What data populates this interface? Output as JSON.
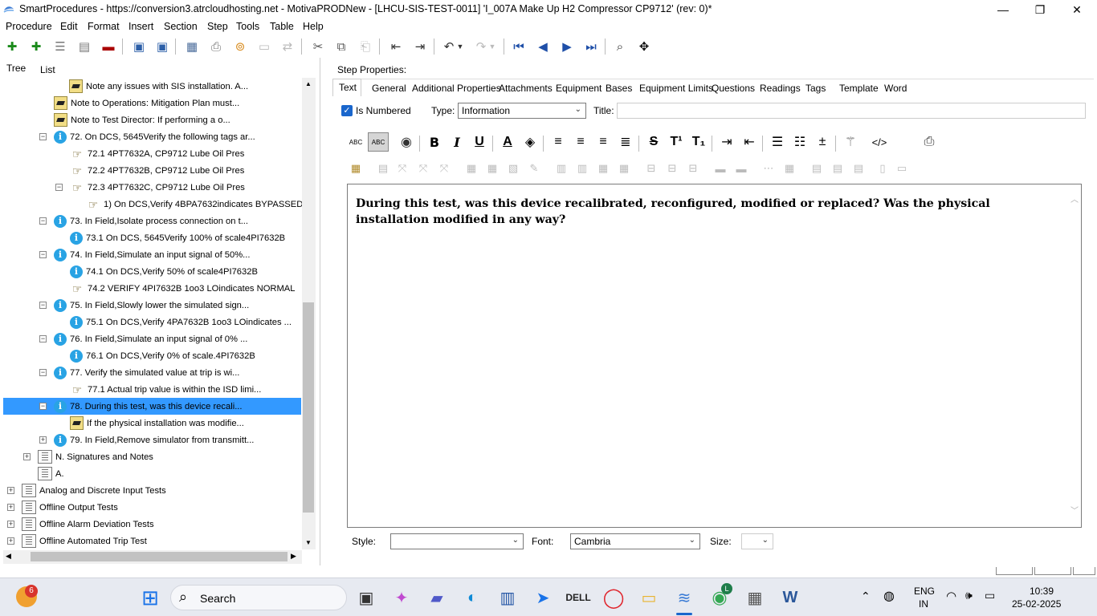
{
  "window": {
    "title": "SmartProcedures - https://conversion3.atrcloudhosting.net - MotivaPRODNew - [LHCU-SIS-TEST-0011] 'I_007A Make Up H2 Compressor CP9712' (rev: 0)*",
    "minimize": "—",
    "restore": "❐",
    "close": "✕"
  },
  "menu": [
    "Procedure",
    "Edit",
    "Format",
    "Insert",
    "Section",
    "Step",
    "Tools",
    "Table",
    "Help"
  ],
  "left_tabs": {
    "tree": "Tree",
    "list": "List"
  },
  "tree": [
    {
      "icon": "note",
      "text": "Note any issues with SIS installation. A..."
    },
    {
      "icon": "note",
      "text": "Note to Operations: Mitigation Plan must..."
    },
    {
      "icon": "note",
      "text": "Note to Test Director: If performing a o..."
    },
    {
      "icon": "info",
      "text": "72. On DCS, 5645Verify the following tags ar...",
      "expander": "−"
    },
    {
      "icon": "hand",
      "text": "72.1 4PT7632A, CP9712 Lube Oil Pres"
    },
    {
      "icon": "hand",
      "text": "72.2 4PT7632B, CP9712 Lube Oil Pres"
    },
    {
      "icon": "hand",
      "text": "72.3 4PT7632C, CP9712 Lube Oil Pres",
      "expander": "−"
    },
    {
      "icon": "hand",
      "text": "1) On DCS,Verify 4BPA7632indicates BYPASSED"
    },
    {
      "icon": "info",
      "text": "73. In Field,Isolate process connection on t...",
      "expander": "−"
    },
    {
      "icon": "info",
      "text": "73.1 On DCS, 5645Verify 100% of scale4PI7632B"
    },
    {
      "icon": "info",
      "text": "74. In Field,Simulate an input signal of 50%...",
      "expander": "−"
    },
    {
      "icon": "info",
      "text": "74.1 On DCS,Verify 50% of scale4PI7632B"
    },
    {
      "icon": "hand",
      "text": "74.2 VERIFY 4PI7632B 1oo3 LOindicates NORMAL"
    },
    {
      "icon": "info",
      "text": "75. In Field,Slowly lower the simulated sign...",
      "expander": "−"
    },
    {
      "icon": "info",
      "text": "75.1 On DCS,Verify 4PA7632B 1oo3 LOindicates ..."
    },
    {
      "icon": "info",
      "text": "76. In Field,Simulate an input signal of 0% ...",
      "expander": "−"
    },
    {
      "icon": "info",
      "text": "76.1 On DCS,Verify 0% of scale.4PI7632B"
    },
    {
      "icon": "info",
      "text": "77. Verify the simulated value at trip is wi...",
      "expander": "−"
    },
    {
      "icon": "hand",
      "text": "77.1 Actual trip value is within the ISD limi..."
    },
    {
      "icon": "info",
      "text": "78. During this test, was this device recali...",
      "expander": "−",
      "selected": true
    },
    {
      "icon": "note",
      "text": "If the physical installation was modifie..."
    },
    {
      "icon": "info",
      "text": "79. In Field,Remove simulator from transmitt...",
      "expander": "+"
    },
    {
      "icon": "section",
      "text": "N. Signatures and Notes",
      "expander": "+"
    },
    {
      "icon": "section",
      "text": "A."
    },
    {
      "icon": "section",
      "text": "Analog and Discrete Input Tests",
      "expander": "+"
    },
    {
      "icon": "section",
      "text": "Offline Output Tests",
      "expander": "+"
    },
    {
      "icon": "section",
      "text": "Offline Alarm Deviation Tests",
      "expander": "+"
    },
    {
      "icon": "section",
      "text": "Offline Automated Trip Test",
      "expander": "+"
    }
  ],
  "step_properties": {
    "heading": "Step Properties:",
    "tabs": [
      "Text",
      "General",
      "Additional Properties",
      "Attachments",
      "Equipment",
      "Bases",
      "Equipment Limits",
      "Questions",
      "Readings",
      "Tags",
      "Template",
      "Word"
    ],
    "active_tab": "Text",
    "is_numbered_label": "Is Numbered",
    "is_numbered_checked": true,
    "type_label": "Type:",
    "type_value": "Information",
    "title_label": "Title:",
    "title_value": ""
  },
  "editor": {
    "content": "During this test, was this device recalibrated, reconfigured, modified or replaced? Was the physical installation modified in any way?"
  },
  "format_bar": {
    "style_label": "Style:",
    "style_value": "",
    "font_label": "Font:",
    "font_value": "Cambria",
    "size_label": "Size:",
    "size_value": ""
  },
  "taskbar": {
    "search_label": "Search",
    "notification_count": "6",
    "language_line1": "ENG",
    "language_line2": "IN",
    "time": "10:39",
    "date": "25-02-2025",
    "chrome_badge": "L"
  },
  "colors": {
    "selection": "#3399ff",
    "info_icon": "#29a3e4",
    "taskbar": "#e7eaf1"
  }
}
